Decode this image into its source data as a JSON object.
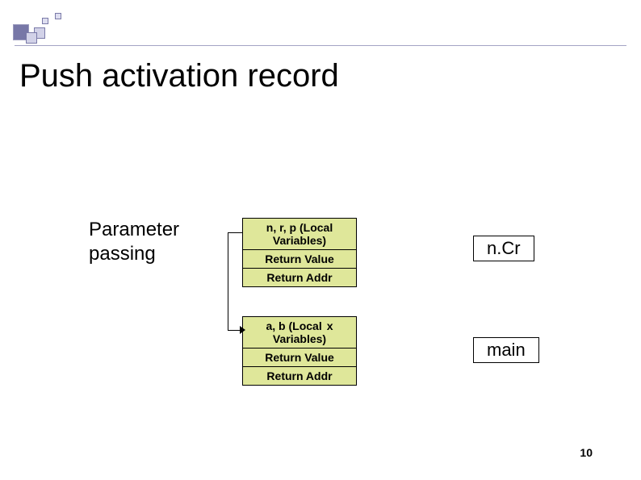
{
  "title": "Push activation record",
  "side_label": {
    "line1": "Parameter",
    "line2": "passing"
  },
  "records": [
    {
      "name": "n.Cr",
      "rows": {
        "0": {
          "l1": "n, r, p (Local",
          "l2": "Variables)"
        },
        "1": "Return Value",
        "2": "Return Addr"
      }
    },
    {
      "name": "main",
      "rows": {
        "0": {
          "l1a": "a, b (Local",
          "l1b": "x",
          "l2": "Variables)"
        },
        "1": "Return Value",
        "2": "Return Addr"
      }
    }
  ],
  "tags": [
    "n.Cr",
    "main"
  ],
  "page": "10",
  "colors": {
    "record_fill": "#dfe79a",
    "deco_dark": "#4a4a8a",
    "deco_light": "#d2d2e8"
  }
}
